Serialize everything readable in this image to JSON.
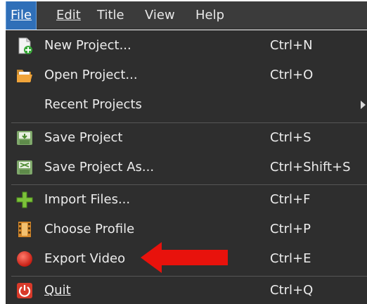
{
  "menubar": {
    "items": [
      {
        "label": "File",
        "active": true
      },
      {
        "label": "Edit",
        "active": false
      },
      {
        "label": "Title",
        "active": false
      },
      {
        "label": "View",
        "active": false
      },
      {
        "label": "Help",
        "active": false
      }
    ]
  },
  "file_menu": {
    "items": [
      {
        "label": "New Project...",
        "shortcut": "Ctrl+N",
        "icon": "new-project-icon"
      },
      {
        "label": "Open Project...",
        "shortcut": "Ctrl+O",
        "icon": "open-folder-icon"
      },
      {
        "label": "Recent Projects",
        "shortcut": "",
        "icon": "",
        "submenu": true
      },
      {
        "label": "Save Project",
        "shortcut": "Ctrl+S",
        "icon": "save-icon"
      },
      {
        "label": "Save Project As...",
        "shortcut": "Ctrl+Shift+S",
        "icon": "save-as-icon"
      },
      {
        "label": "Import Files...",
        "shortcut": "Ctrl+F",
        "icon": "plus-icon"
      },
      {
        "label": "Choose Profile",
        "shortcut": "Ctrl+P",
        "icon": "film-strip-icon"
      },
      {
        "label": "Export Video",
        "shortcut": "Ctrl+E",
        "icon": "record-icon"
      },
      {
        "label": "Quit",
        "shortcut": "Ctrl+Q",
        "icon": "power-icon"
      }
    ]
  },
  "colors": {
    "menubar_bg": "#3b3b3b",
    "menu_bg": "#2e2e2e",
    "active_bg": "#2f6fb8",
    "annotation_arrow": "#e8120c"
  }
}
